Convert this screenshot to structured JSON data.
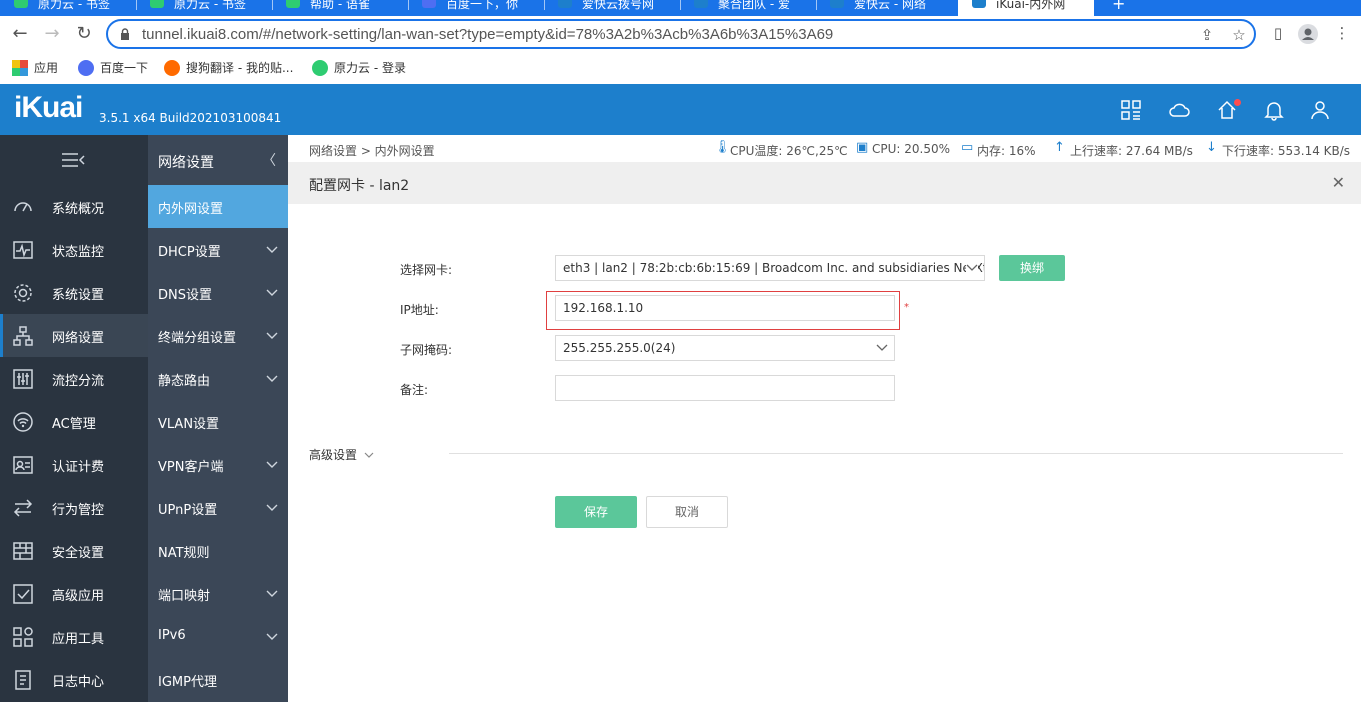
{
  "browser": {
    "tabs": [
      {
        "label": "原力云 - 书签",
        "icon_color": "#2ecc71"
      },
      {
        "label": "原力云 - 书签",
        "icon_color": "#2ecc71"
      },
      {
        "label": "帮助 - 语雀",
        "icon_color": "#2ecc71"
      },
      {
        "label": "百度一下，你",
        "icon_color": "#4e6ef2"
      },
      {
        "label": "爱快云拨号网",
        "icon_color": "#1d7fcc"
      },
      {
        "label": "聚合团队 - 爱",
        "icon_color": "#1d7fcc"
      },
      {
        "label": "爱快云 - 网络",
        "icon_color": "#1d7fcc"
      },
      {
        "label": "iKuai-内外网",
        "icon_color": "#1d7fcc"
      }
    ],
    "new_tab": "+",
    "url": "tunnel.ikuai8.com/#/network-setting/lan-wan-set?type=empty&id=78%3A2b%3Acb%3A6b%3A15%3A69",
    "bookmarks": [
      {
        "label": "应用",
        "icon_color": "#e74c3c"
      },
      {
        "label": "百度一下",
        "icon_color": "#4e6ef2"
      },
      {
        "label": "搜狗翻译 - 我的贴...",
        "icon_color": "#ff6a00"
      },
      {
        "label": "原力云 - 登录",
        "icon_color": "#2ecc71"
      }
    ]
  },
  "app": {
    "logo": "iKuai",
    "version": "3.5.1 x64 Build202103100841",
    "accent_color": "#1d7fcc"
  },
  "main_nav": [
    {
      "label": "系统概况",
      "icon": "dashboard-icon"
    },
    {
      "label": "状态监控",
      "icon": "pulse-icon"
    },
    {
      "label": "系统设置",
      "icon": "gear-icon"
    },
    {
      "label": "网络设置",
      "icon": "network-icon",
      "active": true
    },
    {
      "label": "流控分流",
      "icon": "sliders-icon"
    },
    {
      "label": "AC管理",
      "icon": "wifi-icon"
    },
    {
      "label": "认证计费",
      "icon": "id-card-icon"
    },
    {
      "label": "行为管控",
      "icon": "transfer-icon"
    },
    {
      "label": "安全设置",
      "icon": "firewall-icon"
    },
    {
      "label": "高级应用",
      "icon": "checkbox-icon"
    },
    {
      "label": "应用工具",
      "icon": "tools-icon"
    },
    {
      "label": "日志中心",
      "icon": "log-icon"
    }
  ],
  "sub_nav": {
    "title": "网络设置",
    "items": [
      {
        "label": "内外网设置",
        "active": true,
        "has_children": false
      },
      {
        "label": "DHCP设置",
        "has_children": true
      },
      {
        "label": "DNS设置",
        "has_children": true
      },
      {
        "label": "终端分组设置",
        "has_children": true
      },
      {
        "label": "静态路由",
        "has_children": true
      },
      {
        "label": "VLAN设置",
        "has_children": false
      },
      {
        "label": "VPN客户端",
        "has_children": true
      },
      {
        "label": "UPnP设置",
        "has_children": true
      },
      {
        "label": "NAT规则",
        "has_children": false
      },
      {
        "label": "端口映射",
        "has_children": true
      },
      {
        "label": "IPv6",
        "has_children": true
      },
      {
        "label": "IGMP代理",
        "has_children": false
      }
    ]
  },
  "status": {
    "breadcrumb": "网络设置 > 内外网设置",
    "cpu_temp": "CPU温度: 26℃,25℃",
    "cpu": "CPU: 20.50%",
    "memory": "内存: 16%",
    "upload": "上行速率: 27.64 MB/s",
    "download": "下行速率: 553.14 KB/s"
  },
  "panel": {
    "title": "配置网卡 - lan2",
    "close": "✕",
    "fields": {
      "nic_label": "选择网卡:",
      "nic_value": "eth3 | lan2 | 78:2b:cb:6b:15:69 | Broadcom Inc. and subsidiaries NetXtreme",
      "rebind": "换绑",
      "ip_label": "IP地址:",
      "ip_value": "192.168.1.10",
      "required_mark": "*",
      "mask_label": "子网掩码:",
      "mask_value": "255.255.255.0(24)",
      "remark_label": "备注:",
      "remark_value": ""
    },
    "advanced": "高级设置",
    "save": "保存",
    "cancel": "取消"
  }
}
